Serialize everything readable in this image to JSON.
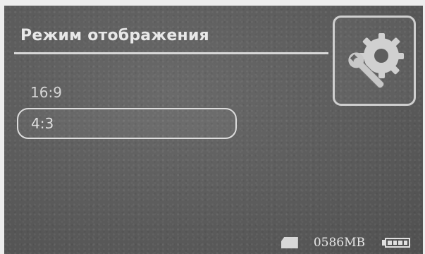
{
  "header": {
    "title": "Режим отображения"
  },
  "options": [
    {
      "label": "16:9",
      "selected": false
    },
    {
      "label": "4:3",
      "selected": true
    }
  ],
  "status_bar": {
    "storage_icon": "sd-card-icon",
    "memory": "0586MB",
    "battery_icon": "battery-icon",
    "battery_level": 1.0
  },
  "icons": {
    "settings": "settings-gear-wrench-icon"
  }
}
